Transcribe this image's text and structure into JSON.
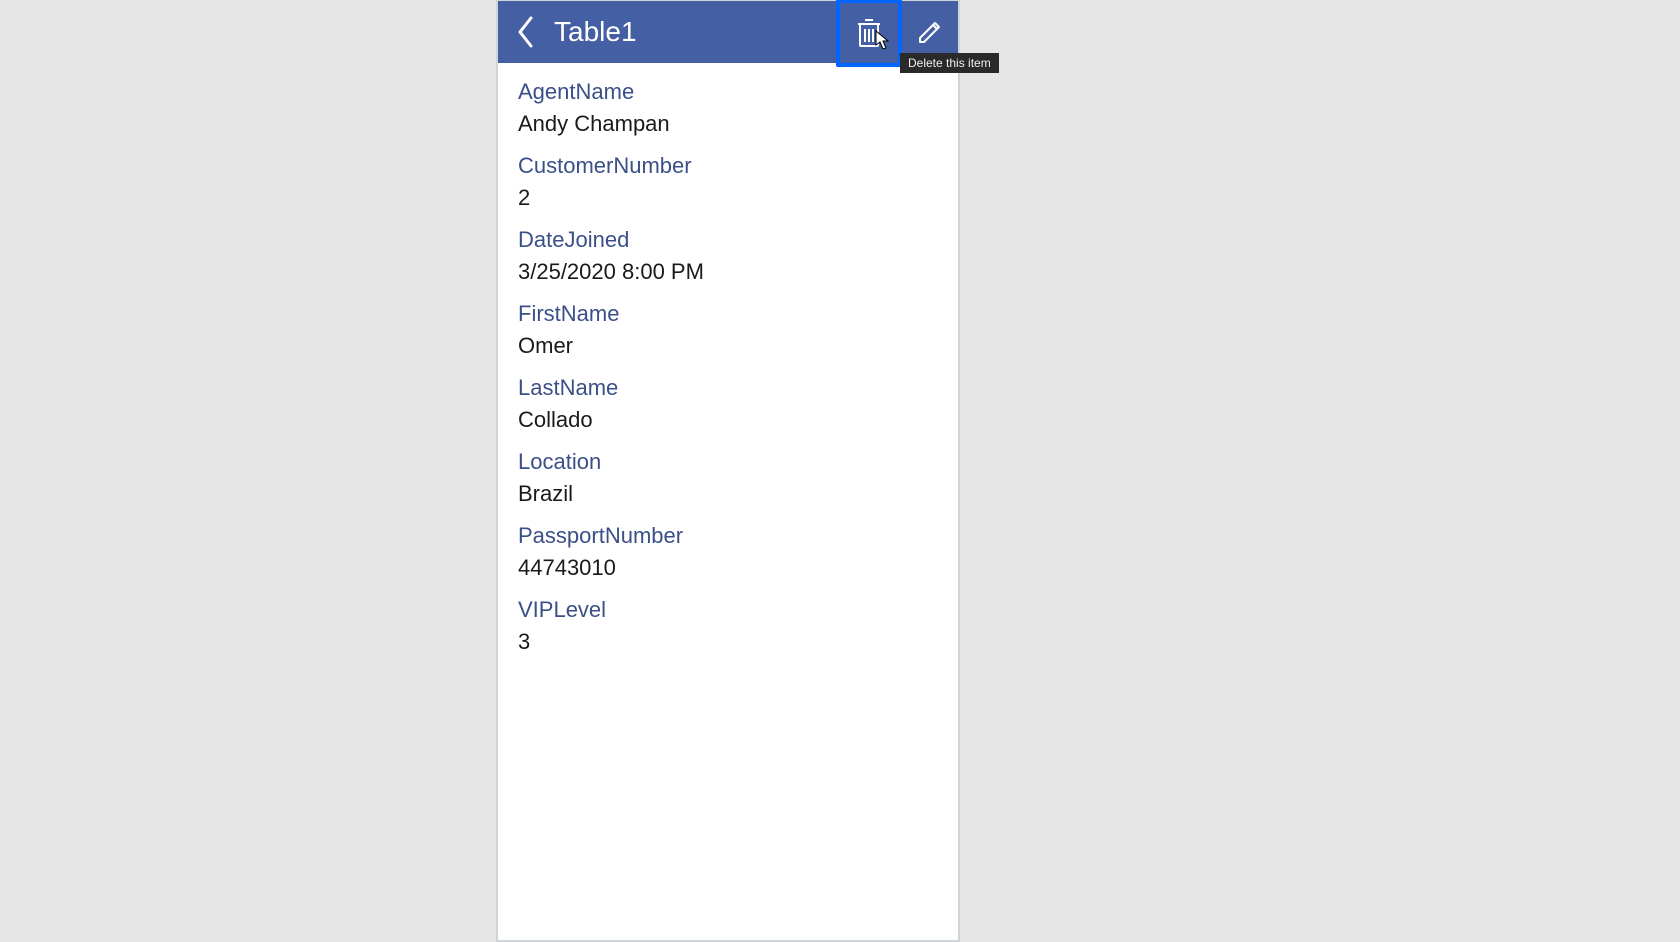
{
  "header": {
    "title": "Table1",
    "tooltip_delete": "Delete this item"
  },
  "fields": [
    {
      "label": "AgentName",
      "value": "Andy Champan"
    },
    {
      "label": "CustomerNumber",
      "value": "2"
    },
    {
      "label": "DateJoined",
      "value": "3/25/2020 8:00 PM"
    },
    {
      "label": "FirstName",
      "value": "Omer"
    },
    {
      "label": "LastName",
      "value": "Collado"
    },
    {
      "label": "Location",
      "value": "Brazil"
    },
    {
      "label": "PassportNumber",
      "value": "44743010"
    },
    {
      "label": "VIPLevel",
      "value": "3"
    }
  ]
}
